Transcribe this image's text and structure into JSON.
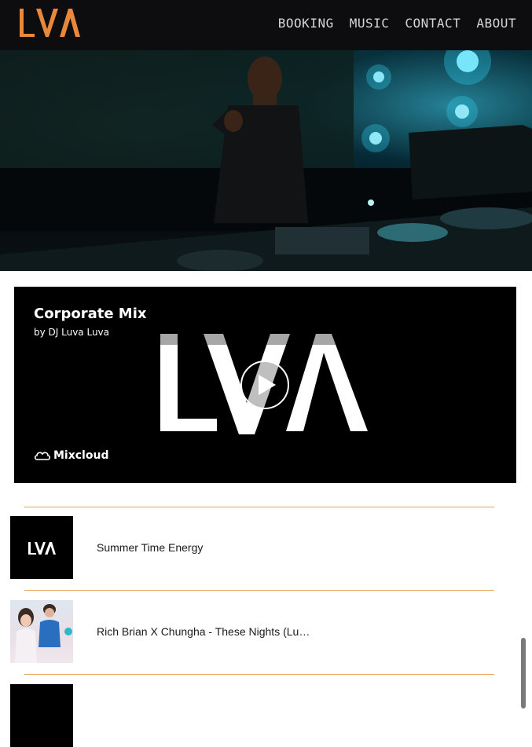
{
  "header": {
    "logo_text": "LVA",
    "nav": [
      "BOOKING",
      "MUSIC",
      "CONTACT",
      "ABOUT"
    ]
  },
  "player": {
    "title": "Corporate Mix",
    "artist": "by DJ Luva Luva",
    "brand": "Mixcloud",
    "art_text": "LVA"
  },
  "tracks": [
    {
      "title": "Summer Time Energy",
      "thumb": "lva-logo"
    },
    {
      "title": "Rich Brian X Chungha - These Nights (Lu…",
      "thumb": "photo"
    },
    {
      "title": "",
      "thumb": "lva-logo"
    }
  ],
  "colors": {
    "accent": "#e8883a",
    "header_bg": "#0d0d0f",
    "divider": "#e8a65c"
  }
}
